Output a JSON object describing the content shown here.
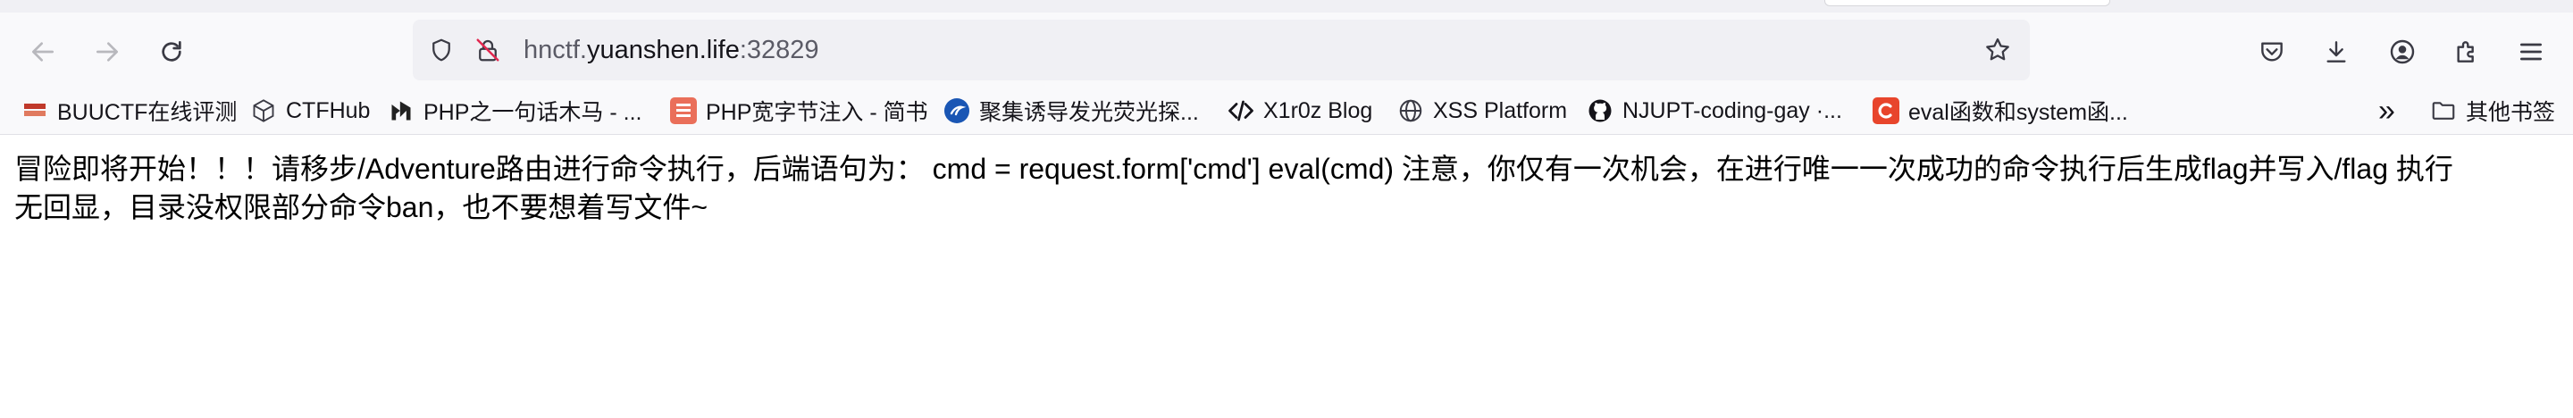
{
  "browser": {
    "url_host_prefix": "hnctf.",
    "url_domain": "yuanshen.life",
    "url_port": ":32829",
    "icons": [
      "back-arrow-icon",
      "forward-arrow-icon",
      "reload-icon",
      "shield-icon",
      "insecure-lock-icon",
      "star-icon",
      "pocket-icon",
      "download-icon",
      "account-icon",
      "extensions-icon",
      "menu-icon"
    ]
  },
  "bookmarks": {
    "items": [
      {
        "label": "BUUCTF在线评测"
      },
      {
        "label": "CTFHub"
      },
      {
        "label": "PHP之一句话木马 - ..."
      },
      {
        "label": "PHP宽字节注入 - 简书"
      },
      {
        "label": "聚集诱导发光荧光探..."
      },
      {
        "label": "X1r0z Blog"
      },
      {
        "label": "XSS Platform"
      },
      {
        "label": "NJUPT-coding-gay ·..."
      },
      {
        "label": "eval函数和system函..."
      }
    ],
    "overflow_glyph": "»",
    "other_label": "其他书签",
    "colors": {
      "buuctf": "#c0392b",
      "jianshu": "#ea6f5a",
      "eval": "#e8452c",
      "blue_circle": "#1a56b4"
    }
  },
  "page": {
    "line1": "冒险即将开始！！！请移步/Adventure路由进行命令执行，后端语句为： cmd = request.form['cmd'] eval(cmd) 注意，你仅有一次机会，在进行唯一一次成功的命令执行后生成flag并写入/flag 执行",
    "line2": "无回显，目录没权限部分命令ban，也不要想着写文件~"
  }
}
